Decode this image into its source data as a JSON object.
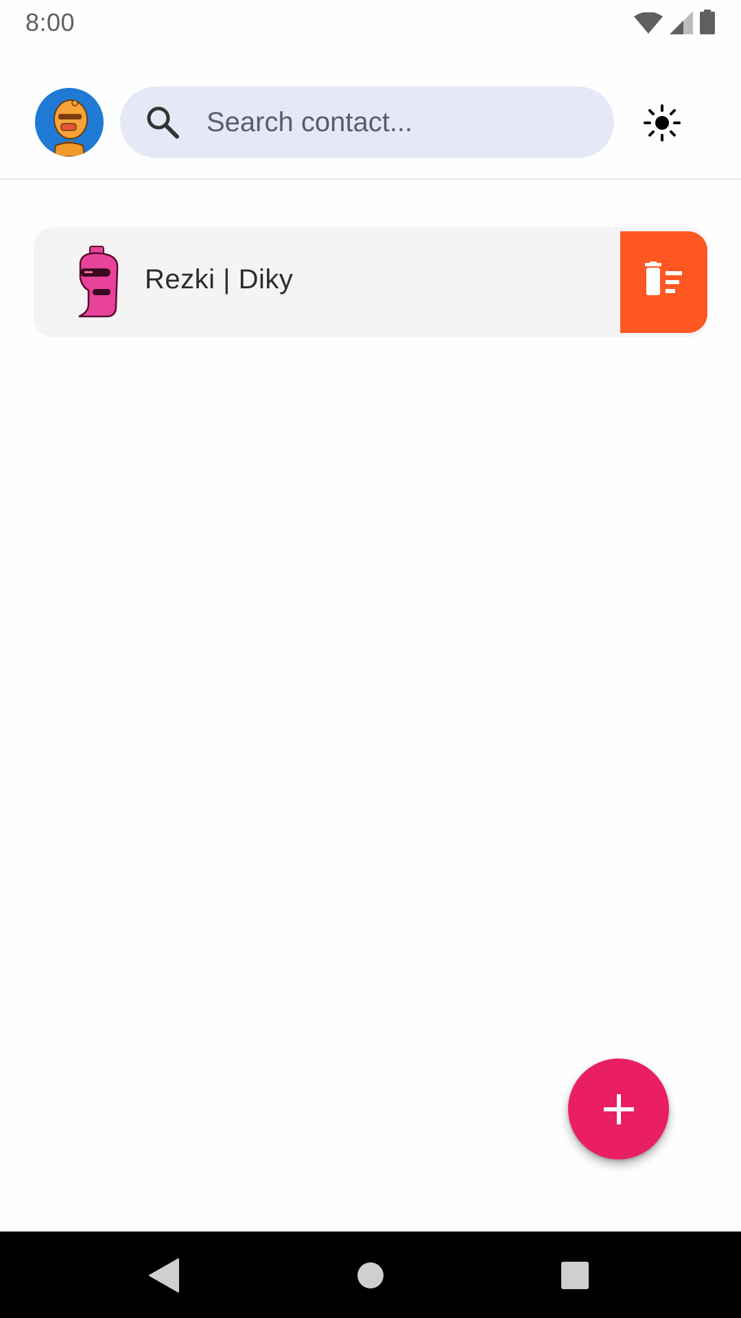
{
  "status_bar": {
    "time": "8:00",
    "icons": [
      "wifi-icon",
      "cellular-signal-icon",
      "battery-icon"
    ]
  },
  "header": {
    "avatar_icon": "orange-monster-avatar",
    "search": {
      "placeholder": "Search contact...",
      "value": ""
    },
    "theme_toggle_icon": "sun-icon"
  },
  "contacts": [
    {
      "name": "Rezki | Diky",
      "avatar_icon": "pink-monster-avatar",
      "delete_icon": "delete-sweep-icon"
    }
  ],
  "fab": {
    "icon": "plus-icon"
  },
  "nav_bar": {
    "icons": [
      "back-icon",
      "home-icon",
      "recents-icon"
    ]
  },
  "colors": {
    "avatar_bg": "#1f7ad6",
    "search_bg": "#e5e9f7",
    "card_bg": "#f4f4f4",
    "delete_bg": "#ff5722",
    "fab_bg": "#e91e63",
    "nav_bg": "#000000"
  }
}
